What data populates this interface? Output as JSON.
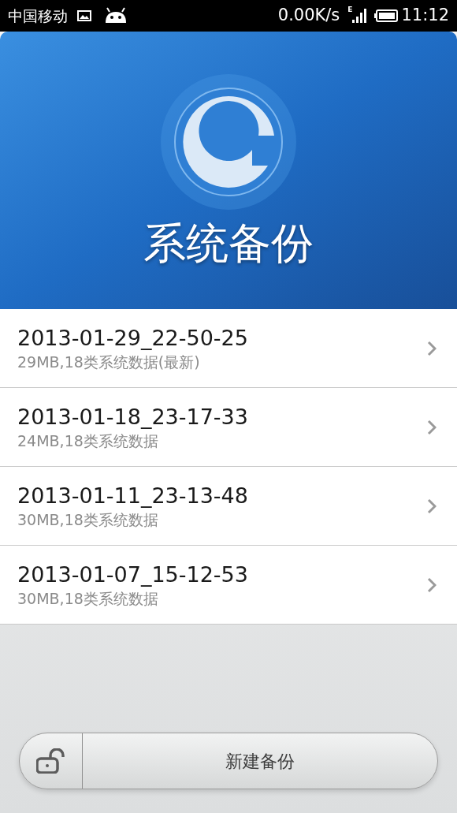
{
  "status_bar": {
    "carrier": "中国移动",
    "speed": "0.00K/s",
    "network": "E",
    "time": "11:12"
  },
  "header": {
    "title": "系统备份"
  },
  "backups": [
    {
      "name": "2013-01-29_22-50-25",
      "detail": "29MB,18类系统数据(最新)"
    },
    {
      "name": "2013-01-18_23-17-33",
      "detail": "24MB,18类系统数据"
    },
    {
      "name": "2013-01-11_23-13-48",
      "detail": "30MB,18类系统数据"
    },
    {
      "name": "2013-01-07_15-12-53",
      "detail": "30MB,18类系统数据"
    }
  ],
  "new_backup_button": {
    "label": "新建备份"
  }
}
